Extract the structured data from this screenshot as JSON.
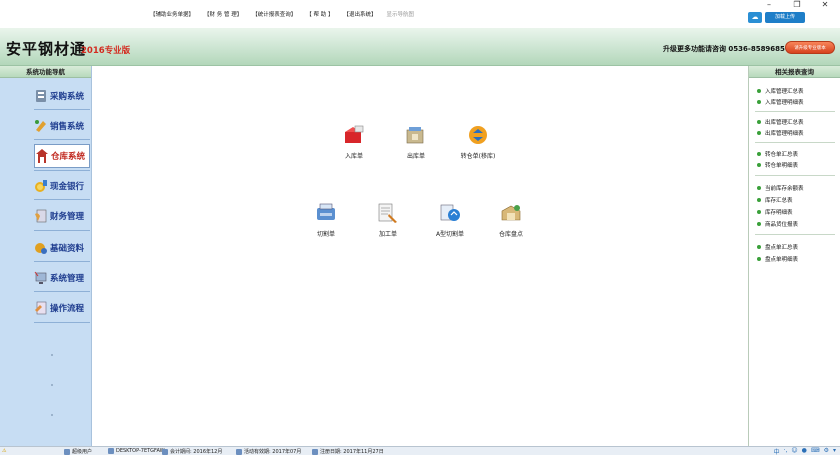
{
  "menu": [
    "【辅助业务单据】",
    "【财 务 管 理】",
    "【统计报表查询】",
    "【 帮 助 】",
    "【退出系统】",
    "显示导航图"
  ],
  "window_controls": [
    "–",
    "❐",
    "✕"
  ],
  "cloud_button": "加载上传",
  "header": {
    "title": "安平钢材通",
    "edition": "2016专业版",
    "upgrade_text": "升级更多功能请咨询 0536-8589685",
    "pro_button": "请升级专业版本"
  },
  "leftnav": {
    "title": "系统功能导航",
    "items": [
      {
        "label": "采购系统",
        "icon": "purchase-icon"
      },
      {
        "label": "销售系统",
        "icon": "sales-icon"
      },
      {
        "label": "仓库系统",
        "icon": "warehouse-icon",
        "active": true
      },
      {
        "label": "现金银行",
        "icon": "cash-bank-icon"
      },
      {
        "label": "财务管理",
        "icon": "finance-icon"
      },
      {
        "label": "基础资料",
        "icon": "basic-data-icon"
      },
      {
        "label": "系统管理",
        "icon": "system-admin-icon"
      },
      {
        "label": "操作流程",
        "icon": "workflow-icon"
      }
    ]
  },
  "modules": [
    {
      "label": "入库单",
      "icon": "inbound-icon"
    },
    {
      "label": "出库单",
      "icon": "outbound-icon"
    },
    {
      "label": "转仓单(移库)",
      "icon": "transfer-icon"
    },
    {
      "label": "切割单",
      "icon": "cutting-icon"
    },
    {
      "label": "加工单",
      "icon": "processing-icon"
    },
    {
      "label": "A型切割单",
      "icon": "a-cutting-icon"
    },
    {
      "label": "仓库盘点",
      "icon": "inventory-check-icon"
    }
  ],
  "rightpanel": {
    "title": "相关报表查询",
    "groups": [
      [
        "入库管理汇总表",
        "入库管理明细表"
      ],
      [
        "出库管理汇总表",
        "出库管理明细表"
      ],
      [
        "转仓单汇总表",
        "转仓单明细表"
      ],
      [
        "当前库存余额表",
        "库存汇总表",
        "库存明细表",
        "商品货位报表"
      ],
      [
        "盘点单汇总表",
        "盘点单明细表"
      ]
    ]
  },
  "statusbar": {
    "user": "超级用户",
    "computer": "DESKTOP-7ETGFAW",
    "period": "会计期间: 2016年12月",
    "expiry": "活动有效期: 2017年07月",
    "register": "注册日期: 2017年11月27日"
  },
  "colors": {
    "header_green": "#c9e3cf",
    "nav_blue": "#c7ddf3",
    "edition_red": "#d32a1f"
  }
}
